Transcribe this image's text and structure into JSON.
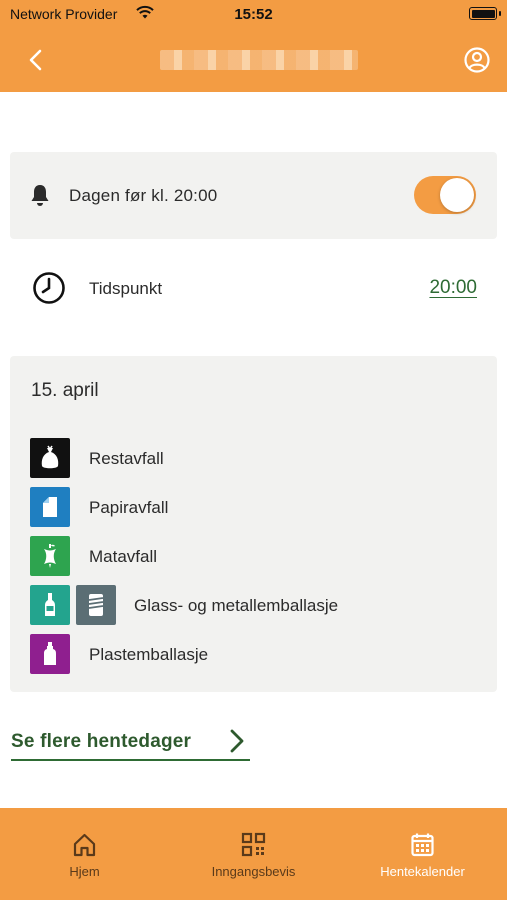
{
  "status_bar": {
    "carrier": "Network Provider",
    "time": "15:52"
  },
  "nav": {
    "back_icon": "chevron-left-icon",
    "profile_icon": "user-circle-icon"
  },
  "notification": {
    "label": "Dagen før kl. 20:00",
    "enabled": true
  },
  "time_setting": {
    "label": "Tidspunkt",
    "value": "20:00"
  },
  "pickup": {
    "date": "15. april",
    "items": [
      {
        "label": "Restavfall",
        "icons": [
          {
            "name": "trash-bag-icon",
            "color": "#111111"
          }
        ]
      },
      {
        "label": "Papiravfall",
        "icons": [
          {
            "name": "paper-icon",
            "color": "#1f7fc1"
          }
        ]
      },
      {
        "label": "Matavfall",
        "icons": [
          {
            "name": "apple-core-icon",
            "color": "#2ea44f"
          }
        ]
      },
      {
        "label": "Glass- og metallemballasje",
        "icons": [
          {
            "name": "glass-bottle-icon",
            "color": "#23a48e"
          },
          {
            "name": "metal-can-icon",
            "color": "#5b6e74"
          }
        ]
      },
      {
        "label": "Plastemballasje",
        "icons": [
          {
            "name": "plastic-bottle-icon",
            "color": "#8f1f8f"
          }
        ]
      }
    ]
  },
  "more_link": {
    "label": "Se flere hentedager"
  },
  "tabs": [
    {
      "label": "Hjem",
      "icon": "home-icon"
    },
    {
      "label": "Inngangsbevis",
      "icon": "qr-code-icon"
    },
    {
      "label": "Hentekalender",
      "icon": "calendar-icon"
    }
  ],
  "colors": {
    "brand": "#f39c43",
    "accent_green": "#2e6b34",
    "card_bg": "#f2f2f0"
  }
}
